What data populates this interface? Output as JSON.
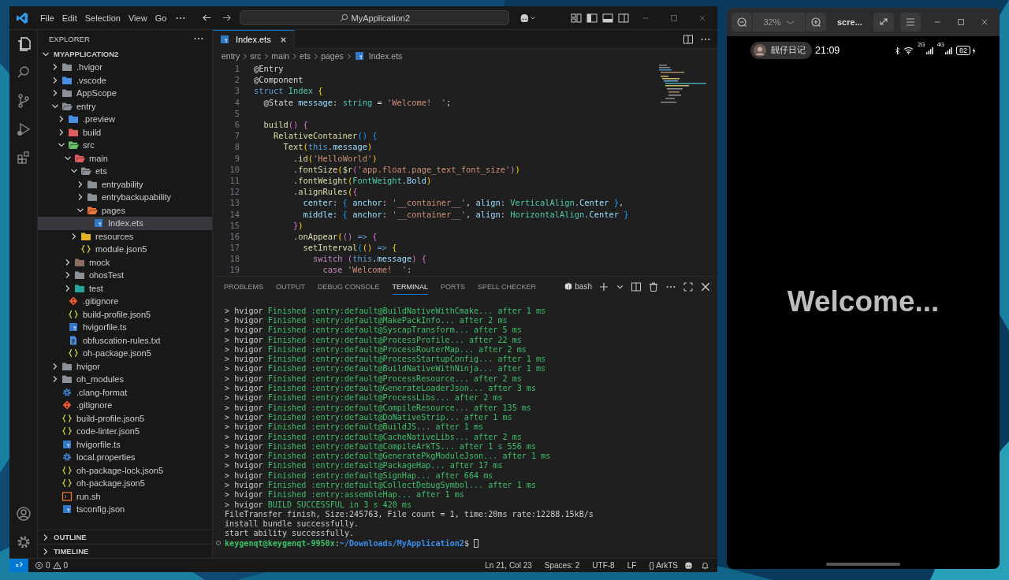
{
  "vscode": {
    "menu": [
      "File",
      "Edit",
      "Selection",
      "View",
      "Go"
    ],
    "command_center": "MyApplication2",
    "explorer": {
      "title": "EXPLORER",
      "root": {
        "label": "MYAPPLICATION2",
        "expanded": true
      },
      "tree": [
        {
          "label": ".hvigor",
          "kind": "folder",
          "color": "#8a9199",
          "expanded": false,
          "selected": false
        },
        {
          "label": ".vscode",
          "kind": "folder",
          "color": "#4a90e2",
          "expanded": false,
          "selected": false
        },
        {
          "label": "AppScope",
          "kind": "folder",
          "color": "#8a9199",
          "expanded": false,
          "selected": false
        },
        {
          "label": "entry",
          "kind": "folder",
          "color": "#8a9199",
          "expanded": true,
          "selected": false,
          "children": [
            {
              "label": ".preview",
              "kind": "folder",
              "color": "#4a90e2",
              "expanded": false,
              "selected": false
            },
            {
              "label": "build",
              "kind": "folder",
              "color": "#e05d5d",
              "expanded": false,
              "selected": false
            },
            {
              "label": "src",
              "kind": "folder",
              "color": "#6abf69",
              "expanded": true,
              "selected": false,
              "children": [
                {
                  "label": "main",
                  "kind": "folder",
                  "color": "#e05d5d",
                  "expanded": true,
                  "selected": false,
                  "children": [
                    {
                      "label": "ets",
                      "kind": "folder",
                      "color": "#8a9199",
                      "expanded": true,
                      "selected": false,
                      "children": [
                        {
                          "label": "entryability",
                          "kind": "folder",
                          "color": "#8a9199",
                          "expanded": false,
                          "selected": false
                        },
                        {
                          "label": "entrybackupability",
                          "kind": "folder",
                          "color": "#8a9199",
                          "expanded": false,
                          "selected": false
                        },
                        {
                          "label": "pages",
                          "kind": "folder",
                          "color": "#e8743b",
                          "expanded": true,
                          "selected": false,
                          "children": [
                            {
                              "label": "Index.ets",
                              "kind": "ts",
                              "selected": true
                            }
                          ]
                        }
                      ]
                    },
                    {
                      "label": "resources",
                      "kind": "folder",
                      "color": "#e6b422",
                      "expanded": false,
                      "selected": false
                    },
                    {
                      "label": "module.json5",
                      "kind": "json",
                      "selected": false
                    }
                  ]
                },
                {
                  "label": "mock",
                  "kind": "folder",
                  "color": "#8d6e63",
                  "expanded": false,
                  "selected": false
                },
                {
                  "label": "ohosTest",
                  "kind": "folder",
                  "color": "#8a9199",
                  "expanded": false,
                  "selected": false
                },
                {
                  "label": "test",
                  "kind": "folder",
                  "color": "#26a69a",
                  "expanded": false,
                  "selected": false
                }
              ]
            },
            {
              "label": ".gitignore",
              "kind": "git",
              "selected": false
            },
            {
              "label": "build-profile.json5",
              "kind": "json",
              "selected": false
            },
            {
              "label": "hvigorfile.ts",
              "kind": "ts",
              "selected": false
            },
            {
              "label": "obfuscation-rules.txt",
              "kind": "txt",
              "selected": false
            },
            {
              "label": "oh-package.json5",
              "kind": "json",
              "selected": false
            }
          ]
        },
        {
          "label": "hvigor",
          "kind": "folder",
          "color": "#8a9199",
          "expanded": false,
          "selected": false
        },
        {
          "label": "oh_modules",
          "kind": "folder",
          "color": "#8a9199",
          "expanded": false,
          "selected": false
        },
        {
          "label": ".clang-format",
          "kind": "gear",
          "selected": false
        },
        {
          "label": ".gitignore",
          "kind": "git",
          "selected": false
        },
        {
          "label": "build-profile.json5",
          "kind": "json",
          "selected": false
        },
        {
          "label": "code-linter.json5",
          "kind": "json",
          "selected": false
        },
        {
          "label": "hvigorfile.ts",
          "kind": "ts",
          "selected": false
        },
        {
          "label": "local.properties",
          "kind": "gear",
          "selected": false
        },
        {
          "label": "oh-package-lock.json5",
          "kind": "json",
          "selected": false
        },
        {
          "label": "oh-package.json5",
          "kind": "json",
          "selected": false
        },
        {
          "label": "run.sh",
          "kind": "shell",
          "selected": false
        },
        {
          "label": "tsconfig.json",
          "kind": "ts",
          "selected": false
        }
      ]
    },
    "sections": [
      {
        "label": "OUTLINE",
        "expanded": false
      },
      {
        "label": "TIMELINE",
        "expanded": false
      }
    ],
    "editor_tabs": [
      {
        "label": "Index.ets",
        "selected": true
      }
    ],
    "breadcrumb": [
      "entry",
      "src",
      "main",
      "ets",
      "pages",
      "Index.ets"
    ],
    "code": [
      {
        "number": "1",
        "tokens": [
          {
            "text": "@Entry",
            "kind": "p"
          }
        ]
      },
      {
        "number": "2",
        "tokens": [
          {
            "text": "@Component",
            "kind": "p"
          }
        ]
      },
      {
        "number": "3",
        "tokens": [
          {
            "text": "struct ",
            "kind": "kw"
          },
          {
            "text": "Index ",
            "kind": "ty"
          },
          {
            "text": "{",
            "kind": "y"
          }
        ]
      },
      {
        "number": "4",
        "tokens": [
          {
            "text": "  @State ",
            "kind": "p"
          },
          {
            "text": "message",
            "kind": "v"
          },
          {
            "text": ": ",
            "kind": "p"
          },
          {
            "text": "string",
            "kind": "ty"
          },
          {
            "text": " = ",
            "kind": "p"
          },
          {
            "text": "'Welcome!  '",
            "kind": "s"
          },
          {
            "text": ";",
            "kind": "p"
          }
        ]
      },
      {
        "number": "5"
      },
      {
        "number": "6",
        "tokens": [
          {
            "text": "  build",
            "kind": "fn"
          },
          {
            "text": "() ",
            "kind": "m"
          },
          {
            "text": "{",
            "kind": "m"
          }
        ]
      },
      {
        "number": "7",
        "tokens": [
          {
            "text": "    RelativeContainer",
            "kind": "fn"
          },
          {
            "text": "() ",
            "kind": "b"
          },
          {
            "text": "{",
            "kind": "b"
          }
        ]
      },
      {
        "number": "8",
        "tokens": [
          {
            "text": "      Text",
            "kind": "fn"
          },
          {
            "text": "(",
            "kind": "y"
          },
          {
            "text": "this",
            "kind": "kw"
          },
          {
            "text": ".",
            "kind": "p"
          },
          {
            "text": "message",
            "kind": "v"
          },
          {
            "text": ")",
            "kind": "y"
          }
        ]
      },
      {
        "number": "9",
        "tokens": [
          {
            "text": "        .",
            "kind": "p"
          },
          {
            "text": "id",
            "kind": "fn"
          },
          {
            "text": "(",
            "kind": "y"
          },
          {
            "text": "'HelloWorld'",
            "kind": "s"
          },
          {
            "text": ")",
            "kind": "y"
          }
        ]
      },
      {
        "number": "10",
        "tokens": [
          {
            "text": "        .",
            "kind": "p"
          },
          {
            "text": "fontSize",
            "kind": "fn"
          },
          {
            "text": "(",
            "kind": "y"
          },
          {
            "text": "$r",
            "kind": "fn"
          },
          {
            "text": "(",
            "kind": "m"
          },
          {
            "text": "'app.float.page_text_font_size'",
            "kind": "s"
          },
          {
            "text": ")",
            "kind": "m"
          },
          {
            "text": ")",
            "kind": "y"
          }
        ]
      },
      {
        "number": "11",
        "tokens": [
          {
            "text": "        .",
            "kind": "p"
          },
          {
            "text": "fontWeight",
            "kind": "fn"
          },
          {
            "text": "(",
            "kind": "y"
          },
          {
            "text": "FontWeight",
            "kind": "ty"
          },
          {
            "text": ".",
            "kind": "p"
          },
          {
            "text": "Bold",
            "kind": "v"
          },
          {
            "text": ")",
            "kind": "y"
          }
        ]
      },
      {
        "number": "12",
        "tokens": [
          {
            "text": "        .",
            "kind": "p"
          },
          {
            "text": "alignRules",
            "kind": "fn"
          },
          {
            "text": "(",
            "kind": "y"
          },
          {
            "text": "{",
            "kind": "m"
          }
        ]
      },
      {
        "number": "13",
        "tokens": [
          {
            "text": "          center",
            "kind": "v"
          },
          {
            "text": ": ",
            "kind": "p"
          },
          {
            "text": "{ ",
            "kind": "b"
          },
          {
            "text": "anchor",
            "kind": "v"
          },
          {
            "text": ": ",
            "kind": "p"
          },
          {
            "text": "'__container__'",
            "kind": "s"
          },
          {
            "text": ", ",
            "kind": "p"
          },
          {
            "text": "align",
            "kind": "v"
          },
          {
            "text": ": ",
            "kind": "p"
          },
          {
            "text": "VerticalAlign",
            "kind": "ty"
          },
          {
            "text": ".",
            "kind": "p"
          },
          {
            "text": "Center",
            "kind": "v"
          },
          {
            "text": " }",
            "kind": "b"
          },
          {
            "text": ",",
            "kind": "p"
          }
        ]
      },
      {
        "number": "14",
        "tokens": [
          {
            "text": "          middle",
            "kind": "v"
          },
          {
            "text": ": ",
            "kind": "p"
          },
          {
            "text": "{ ",
            "kind": "b"
          },
          {
            "text": "anchor",
            "kind": "v"
          },
          {
            "text": ": ",
            "kind": "p"
          },
          {
            "text": "'__container__'",
            "kind": "s"
          },
          {
            "text": ", ",
            "kind": "p"
          },
          {
            "text": "align",
            "kind": "v"
          },
          {
            "text": ": ",
            "kind": "p"
          },
          {
            "text": "HorizontalAlign",
            "kind": "ty"
          },
          {
            "text": ".",
            "kind": "p"
          },
          {
            "text": "Center",
            "kind": "v"
          },
          {
            "text": " }",
            "kind": "b"
          }
        ]
      },
      {
        "number": "15",
        "tokens": [
          {
            "text": "        }",
            "kind": "m"
          },
          {
            "text": ")",
            "kind": "y"
          }
        ]
      },
      {
        "number": "16",
        "tokens": [
          {
            "text": "        .",
            "kind": "p"
          },
          {
            "text": "onAppear",
            "kind": "fn"
          },
          {
            "text": "(",
            "kind": "y"
          },
          {
            "text": "() ",
            "kind": "m"
          },
          {
            "text": "=> ",
            "kind": "kw"
          },
          {
            "text": "{",
            "kind": "m"
          }
        ]
      },
      {
        "number": "17",
        "tokens": [
          {
            "text": "          setInterval",
            "kind": "fn"
          },
          {
            "text": "(",
            "kind": "b"
          },
          {
            "text": "() ",
            "kind": "y"
          },
          {
            "text": "=> ",
            "kind": "kw"
          },
          {
            "text": "{",
            "kind": "y"
          }
        ]
      },
      {
        "number": "18",
        "tokens": [
          {
            "text": "            switch ",
            "kind": "ctl"
          },
          {
            "text": "(",
            "kind": "m"
          },
          {
            "text": "this",
            "kind": "kw"
          },
          {
            "text": ".",
            "kind": "p"
          },
          {
            "text": "message",
            "kind": "v"
          },
          {
            "text": ") ",
            "kind": "m"
          },
          {
            "text": "{",
            "kind": "m"
          }
        ]
      },
      {
        "number": "19",
        "tokens": [
          {
            "text": "              case ",
            "kind": "ctl"
          },
          {
            "text": "'Welcome!  '",
            "kind": "s"
          },
          {
            "text": ":",
            "kind": "p"
          }
        ]
      }
    ],
    "panel_tabs": [
      {
        "label": "PROBLEMS",
        "selected": false
      },
      {
        "label": "OUTPUT",
        "selected": false
      },
      {
        "label": "DEBUG CONSOLE",
        "selected": false
      },
      {
        "label": "TERMINAL",
        "selected": true
      },
      {
        "label": "PORTS",
        "selected": false
      },
      {
        "label": "SPELL CHECKER",
        "selected": false
      }
    ],
    "terminal": {
      "shell": "bash",
      "lines": [
        {
          "kind": "log",
          "tokens": [
            {
              "text": "> hvigor ",
              "kind": "w"
            },
            {
              "text": "Finished :entry:default@BuildNativeWithCmake... after 1 ms",
              "kind": "g"
            }
          ]
        },
        {
          "kind": "log",
          "tokens": [
            {
              "text": "> hvigor ",
              "kind": "w"
            },
            {
              "text": "Finished :entry:default@MakePackInfo... after 2 ms",
              "kind": "g"
            }
          ]
        },
        {
          "kind": "log",
          "tokens": [
            {
              "text": "> hvigor ",
              "kind": "w"
            },
            {
              "text": "Finished :entry:default@SyscapTransform... after 5 ms",
              "kind": "g"
            }
          ]
        },
        {
          "kind": "log",
          "tokens": [
            {
              "text": "> hvigor ",
              "kind": "w"
            },
            {
              "text": "Finished :entry:default@ProcessProfile... after 22 ms",
              "kind": "g"
            }
          ]
        },
        {
          "kind": "log",
          "tokens": [
            {
              "text": "> hvigor ",
              "kind": "w"
            },
            {
              "text": "Finished :entry:default@ProcessRouterMap... after 2 ms",
              "kind": "g"
            }
          ]
        },
        {
          "kind": "log",
          "tokens": [
            {
              "text": "> hvigor ",
              "kind": "w"
            },
            {
              "text": "Finished :entry:default@ProcessStartupConfig... after 1 ms",
              "kind": "g"
            }
          ]
        },
        {
          "kind": "log",
          "tokens": [
            {
              "text": "> hvigor ",
              "kind": "w"
            },
            {
              "text": "Finished :entry:default@BuildNativeWithNinja... after 1 ms",
              "kind": "g"
            }
          ]
        },
        {
          "kind": "log",
          "tokens": [
            {
              "text": "> hvigor ",
              "kind": "w"
            },
            {
              "text": "Finished :entry:default@ProcessResource... after 2 ms",
              "kind": "g"
            }
          ]
        },
        {
          "kind": "log",
          "tokens": [
            {
              "text": "> hvigor ",
              "kind": "w"
            },
            {
              "text": "Finished :entry:default@GenerateLoaderJson... after 3 ms",
              "kind": "g"
            }
          ]
        },
        {
          "kind": "log",
          "tokens": [
            {
              "text": "> hvigor ",
              "kind": "w"
            },
            {
              "text": "Finished :entry:default@ProcessLibs... after 2 ms",
              "kind": "g"
            }
          ]
        },
        {
          "kind": "log",
          "tokens": [
            {
              "text": "> hvigor ",
              "kind": "w"
            },
            {
              "text": "Finished :entry:default@CompileResource... after 135 ms",
              "kind": "g"
            }
          ]
        },
        {
          "kind": "log",
          "tokens": [
            {
              "text": "> hvigor ",
              "kind": "w"
            },
            {
              "text": "Finished :entry:default@DoNativeStrip... after 1 ms",
              "kind": "g"
            }
          ]
        },
        {
          "kind": "log",
          "tokens": [
            {
              "text": "> hvigor ",
              "kind": "w"
            },
            {
              "text": "Finished :entry:default@BuildJS... after 1 ms",
              "kind": "g"
            }
          ]
        },
        {
          "kind": "log",
          "tokens": [
            {
              "text": "> hvigor ",
              "kind": "w"
            },
            {
              "text": "Finished :entry:default@CacheNativeLibs... after 2 ms",
              "kind": "g"
            }
          ]
        },
        {
          "kind": "log",
          "tokens": [
            {
              "text": "> hvigor ",
              "kind": "w"
            },
            {
              "text": "Finished :entry:default@CompileArkTS... after 1 s 556 ms",
              "kind": "g"
            }
          ]
        },
        {
          "kind": "log",
          "tokens": [
            {
              "text": "> hvigor ",
              "kind": "w"
            },
            {
              "text": "Finished :entry:default@GeneratePkgModuleJson... after 1 ms",
              "kind": "g"
            }
          ]
        },
        {
          "kind": "log",
          "tokens": [
            {
              "text": "> hvigor ",
              "kind": "w"
            },
            {
              "text": "Finished :entry:default@PackageHap... after 17 ms",
              "kind": "g"
            }
          ]
        },
        {
          "kind": "log",
          "tokens": [
            {
              "text": "> hvigor ",
              "kind": "w"
            },
            {
              "text": "Finished :entry:default@SignHap... after 664 ms",
              "kind": "g"
            }
          ]
        },
        {
          "kind": "log",
          "tokens": [
            {
              "text": "> hvigor ",
              "kind": "w"
            },
            {
              "text": "Finished :entry:default@CollectDebugSymbol... after 1 ms",
              "kind": "g"
            }
          ]
        },
        {
          "kind": "log",
          "tokens": [
            {
              "text": "> hvigor ",
              "kind": "w"
            },
            {
              "text": "Finished :entry:assembleHap... after 1 ms",
              "kind": "g"
            }
          ]
        },
        {
          "kind": "log",
          "tokens": [
            {
              "text": "> hvigor ",
              "kind": "w"
            },
            {
              "text": "BUILD SUCCESSFUL in 3 s 420 ms",
              "kind": "g"
            }
          ]
        },
        {
          "kind": "output",
          "tokens": [
            {
              "text": "FileTransfer finish, Size:245763, File count = 1, time:20ms rate:12288.15kB/s",
              "kind": "w"
            }
          ]
        },
        {
          "kind": "output",
          "tokens": [
            {
              "text": "install bundle successfully.",
              "kind": "w"
            }
          ]
        },
        {
          "kind": "output",
          "tokens": [
            {
              "text": "start ability successfully.",
              "kind": "w"
            }
          ]
        },
        {
          "kind": "prompt",
          "tokens": [
            {
              "text": "keygenqt@keygenqt-9950x",
              "kind": "u"
            },
            {
              "text": ":",
              "kind": "w"
            },
            {
              "text": "~/Downloads/MyApplication2",
              "kind": "pth"
            },
            {
              "text": "$",
              "kind": "w"
            }
          ]
        }
      ]
    },
    "status_bar": {
      "errors": "0",
      "warnings": "0",
      "items": [
        "Ln 21, Col 23",
        "Spaces: 2",
        "UTF-8",
        "LF",
        "{} ArkTS"
      ]
    }
  },
  "phone": {
    "toolbar": {
      "zoom": "32%",
      "title": "scre..."
    },
    "status": {
      "app": "靓仔日记",
      "time": "21:09",
      "networks": [
        "2G",
        "4G"
      ],
      "battery": "82",
      "charging": true
    },
    "screen_text": "Welcome..."
  }
}
